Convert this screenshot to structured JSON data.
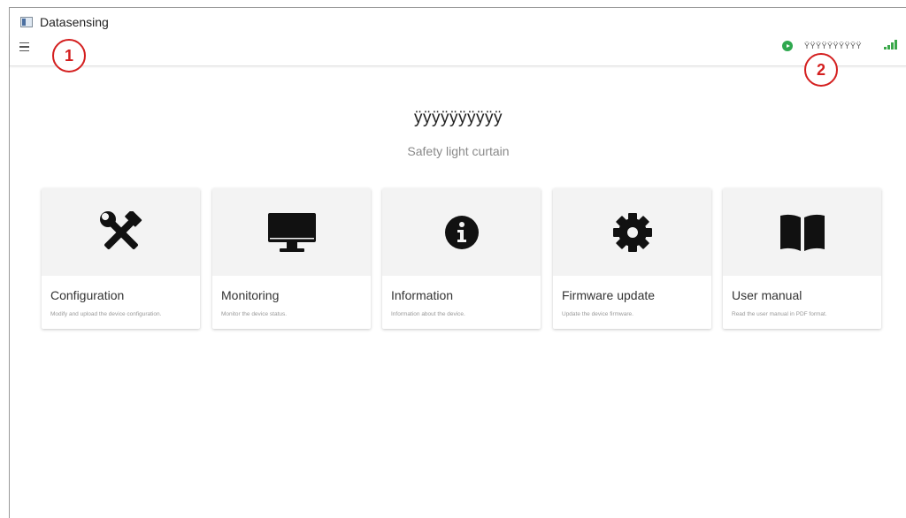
{
  "window": {
    "title": "Datasensing"
  },
  "toolbar": {
    "menu_icon": "hamburger-menu-icon",
    "status_color": "#2fa84f",
    "device_code": "ŸŸŸŸŸŸŸŸŸŸ",
    "signal_icon": "signal-bars-icon"
  },
  "callouts": [
    "1",
    "2"
  ],
  "header": {
    "device_name": "ÿÿÿÿÿÿÿÿÿÿ",
    "device_type": "Safety light curtain"
  },
  "cards": [
    {
      "icon": "tools-icon",
      "title": "Configuration",
      "description": "Modify and upload the device configuration."
    },
    {
      "icon": "monitor-icon",
      "title": "Monitoring",
      "description": "Monitor the device status."
    },
    {
      "icon": "info-icon",
      "title": "Information",
      "description": "Information about the device."
    },
    {
      "icon": "gear-icon",
      "title": "Firmware update",
      "description": "Update the device firmware."
    },
    {
      "icon": "book-icon",
      "title": "User manual",
      "description": "Read the user manual in PDF format."
    }
  ]
}
